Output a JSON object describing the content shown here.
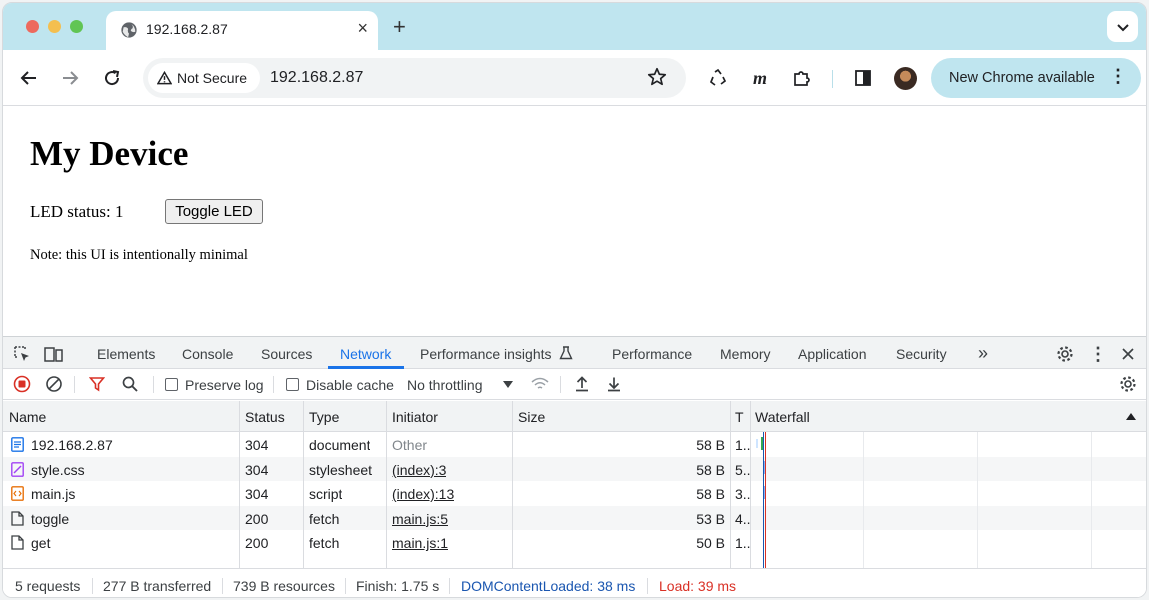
{
  "browser": {
    "tab_title": "192.168.2.87",
    "tab_close": "×",
    "new_tab": "+",
    "security_label": "Not Secure",
    "url": "192.168.2.87",
    "update_label": "New Chrome available",
    "menu_dots": "⋮"
  },
  "page": {
    "heading": "My Device",
    "led_status_text": "LED status: 1",
    "toggle_button": "Toggle LED",
    "note": "Note: this UI is intentionally minimal"
  },
  "devtools": {
    "tabs": [
      {
        "label": "Elements"
      },
      {
        "label": "Console"
      },
      {
        "label": "Sources"
      },
      {
        "label": "Network",
        "active": true
      },
      {
        "label": "Performance insights"
      },
      {
        "label": "Performance"
      },
      {
        "label": "Memory"
      },
      {
        "label": "Application"
      },
      {
        "label": "Security"
      }
    ],
    "more_tabs": "»",
    "toolbar": {
      "preserve_log": "Preserve log",
      "disable_cache": "Disable cache",
      "throttling": "No throttling"
    },
    "columns": {
      "name": "Name",
      "status": "Status",
      "type": "Type",
      "initiator": "Initiator",
      "size": "Size",
      "time": "T",
      "waterfall": "Waterfall"
    },
    "requests": [
      {
        "name": "192.168.2.87",
        "status": "304",
        "type": "document",
        "initiator": "Other",
        "size": "58 B",
        "time": "1..",
        "icon": "document-icon"
      },
      {
        "name": "style.css",
        "status": "304",
        "type": "stylesheet",
        "initiator": "(index):3",
        "size": "58 B",
        "time": "5..",
        "icon": "stylesheet-icon"
      },
      {
        "name": "main.js",
        "status": "304",
        "type": "script",
        "initiator": "(index):13",
        "size": "58 B",
        "time": "3..",
        "icon": "script-icon"
      },
      {
        "name": "toggle",
        "status": "200",
        "type": "fetch",
        "initiator": "main.js:5",
        "size": "53 B",
        "time": "4..",
        "icon": "file-icon"
      },
      {
        "name": "get",
        "status": "200",
        "type": "fetch",
        "initiator": "main.js:1",
        "size": "50 B",
        "time": "1..",
        "icon": "file-icon"
      }
    ],
    "summary": {
      "requests": "5 requests",
      "transferred": "277 B transferred",
      "resources": "739 B resources",
      "finish": "Finish: 1.75 s",
      "dom_loaded": "DOMContentLoaded: 38 ms",
      "load": "Load: 39 ms"
    },
    "colors": {
      "accent": "#1a73e8",
      "dom_loaded": "#1a56b0",
      "load": "#d93025",
      "record": "#d93025"
    }
  }
}
